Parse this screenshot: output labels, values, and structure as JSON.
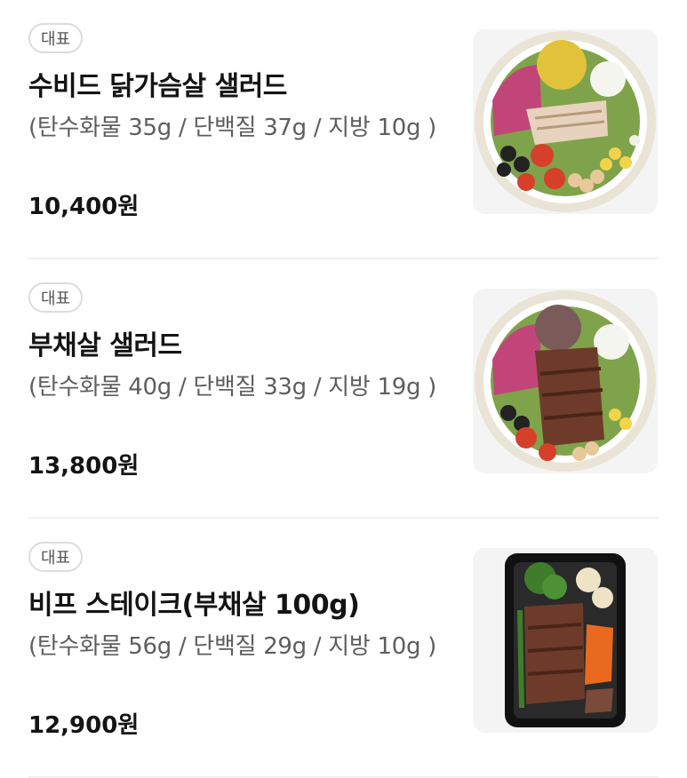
{
  "menu_items": [
    {
      "badge": "대표",
      "name": "수비드 닭가슴살 샐러드",
      "nutrition": "(탄수화물 35g / 단백질 37g / 지방 10g )",
      "price": "10,400원",
      "image_icon": "salad-chicken-bowl-image"
    },
    {
      "badge": "대표",
      "name": "부채살 샐러드",
      "nutrition": "(탄수화물 40g / 단백질 33g / 지방 19g )",
      "price": "13,800원",
      "image_icon": "salad-beef-bowl-image"
    },
    {
      "badge": "대표",
      "name": "비프 스테이크(부채살 100g)",
      "nutrition": "(탄수화물 56g / 단백질 29g / 지방 10g )",
      "price": "12,900원",
      "image_icon": "beef-steak-box-image"
    }
  ]
}
